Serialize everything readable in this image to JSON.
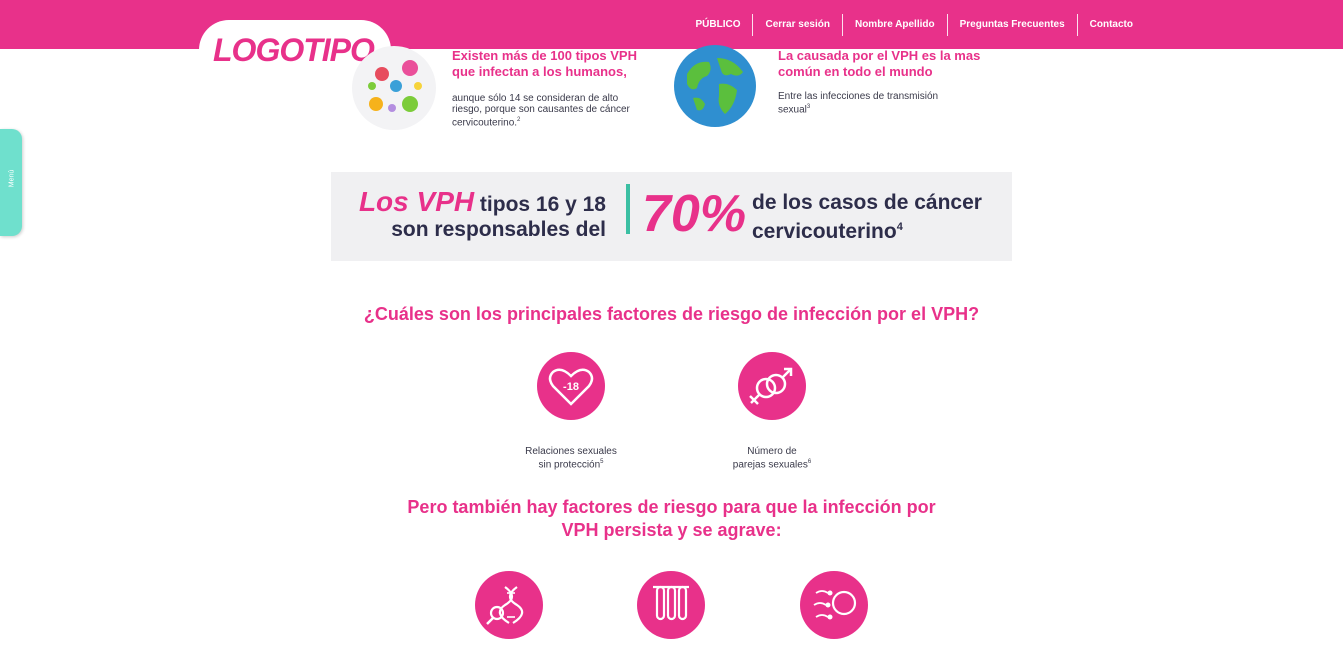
{
  "header": {
    "logo": "LOGOTIPO",
    "nav": [
      "PÚBLICO",
      "Cerrar sesión",
      "Nombre Apellido",
      "Preguntas Frecuentes",
      "Contacto"
    ]
  },
  "side_menu": {
    "label": "Menú"
  },
  "facts": [
    {
      "title_line1": "Existen más de 100 tipos VPH",
      "title_line2": "que infectan a los humanos,",
      "text_line1": "aunque sólo 14 se consideran de alto",
      "text_line2": "riesgo, porque son causantes de cáncer",
      "text_line3": "cervicouterino.",
      "ref": "2",
      "icon": "virus-icon"
    },
    {
      "title_line1": "La causada por el VPH es la mas",
      "title_line2": "común en todo el mundo",
      "text_line1": "Entre las infecciones de transmisión",
      "text_line2": "sexual",
      "ref": "3",
      "icon": "globe-icon"
    }
  ],
  "banner": {
    "highlight": "Los VPH",
    "line1_rest": " tipos 16 y 18",
    "line2": "son responsables del",
    "percent": "70%",
    "right_line1": "de los casos de cáncer",
    "right_line2": "cervicouterino",
    "ref": "4",
    "divider_color": "#3bbfa3"
  },
  "risk_heading": "¿Cuáles son los principales factores de riesgo de infección por el VPH?",
  "risk_factors": [
    {
      "line1": "Relaciones sexuales",
      "line2": "sin protección",
      "ref": "5",
      "icon": "heart-minus-18-icon",
      "badge": "-18"
    },
    {
      "line1": "Número de",
      "line2": "parejas sexuales",
      "ref": "6",
      "icon": "gender-symbols-icon"
    }
  ],
  "persist_heading_line1": "Pero también hay factores de riesgo para que la infección por",
  "persist_heading_line2": "VPH persista y se agrave:",
  "persist_factors": [
    {
      "icon": "dna-magnifier-icon"
    },
    {
      "icon": "test-tubes-icon"
    },
    {
      "icon": "sperm-egg-icon"
    }
  ],
  "colors": {
    "brand_pink": "#e8318a",
    "accent_teal": "#6fe0cd",
    "banner_bg": "#f0f0f2"
  }
}
